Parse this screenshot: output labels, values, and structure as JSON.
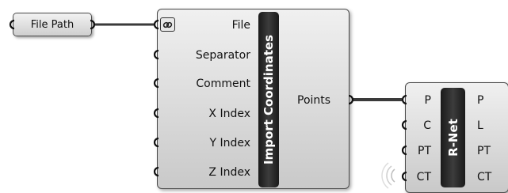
{
  "file_path_param": {
    "label": "File Path"
  },
  "import_coordinates": {
    "title": "Import Coordinates",
    "inputs": [
      "File",
      "Separator",
      "Comment",
      "X Index",
      "Y Index",
      "Z Index"
    ],
    "outputs": [
      "Points"
    ],
    "icon": "link-icon"
  },
  "rnet": {
    "title": "R-Net",
    "inputs": [
      "P",
      "C",
      "PT",
      "CT"
    ],
    "outputs": [
      "P",
      "L",
      "PT",
      "CT"
    ]
  }
}
